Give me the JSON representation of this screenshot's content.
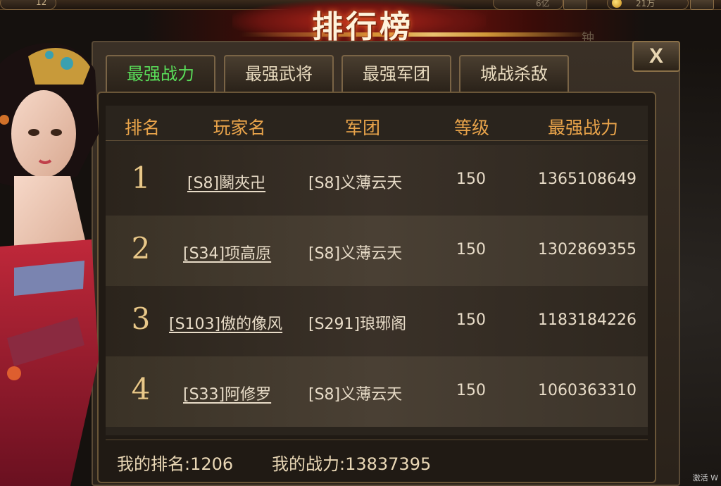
{
  "header": {
    "title": "排行榜",
    "top_right_fragment": "钟"
  },
  "hud": {
    "coin_value": "21万",
    "left_value": "12",
    "mid_value": "6亿"
  },
  "close_label": "X",
  "tabs": [
    {
      "label": "最强战力",
      "active": true
    },
    {
      "label": "最强武将",
      "active": false
    },
    {
      "label": "最强军团",
      "active": false
    },
    {
      "label": "城战杀敌",
      "active": false
    }
  ],
  "table": {
    "columns": [
      "排名",
      "玩家名",
      "军团",
      "等级",
      "最强战力"
    ],
    "rows": [
      {
        "rank": "1",
        "player": "[S8]鬬夾卍",
        "legion": "[S8]义薄云天",
        "level": "150",
        "power": "1365108649"
      },
      {
        "rank": "2",
        "player": "[S34]项高原",
        "legion": "[S8]义薄云天",
        "level": "150",
        "power": "1302869355"
      },
      {
        "rank": "3",
        "player": "[S103]傲的像风",
        "legion": "[S291]琅琊阁",
        "level": "150",
        "power": "1183184226"
      },
      {
        "rank": "4",
        "player": "[S33]阿修罗",
        "legion": "[S8]义薄云天",
        "level": "150",
        "power": "1060363310"
      }
    ]
  },
  "footer": {
    "my_rank": "我的排名:1206",
    "my_power": "我的战力:13837395"
  },
  "watermark": "激活 W",
  "colors": {
    "tab_active": "#5adf5a",
    "header_text": "#e8a34a",
    "title_red": "#b8261a"
  }
}
